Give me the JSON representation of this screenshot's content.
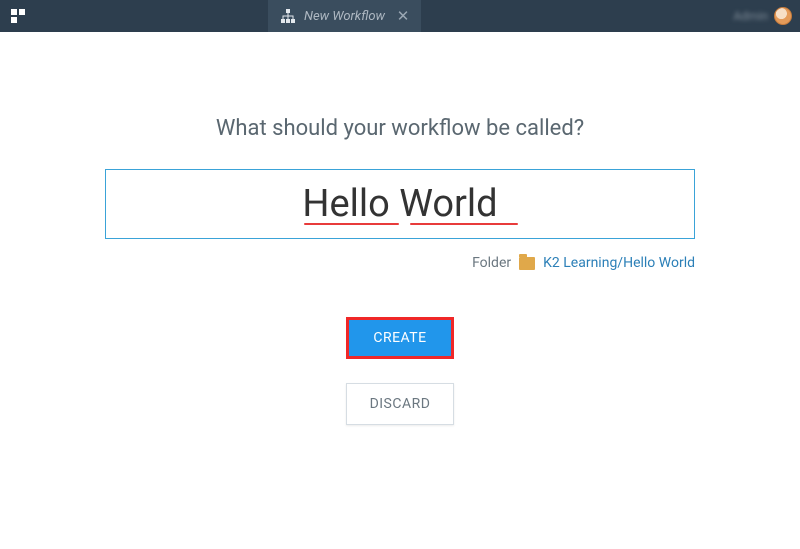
{
  "header": {
    "tab_label": "New Workflow",
    "user_name": "Admin"
  },
  "main": {
    "heading": "What should your workflow be called?",
    "workflow_name": "Hello World",
    "folder_label": "Folder",
    "folder_path": "K2 Learning/Hello World",
    "create_label": "CREATE",
    "discard_label": "DISCARD"
  }
}
